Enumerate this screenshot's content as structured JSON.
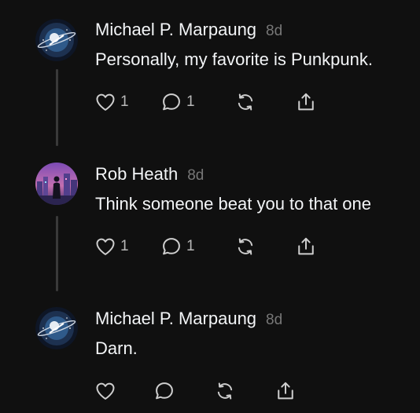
{
  "posts": [
    {
      "username": "Michael P. Marpaung",
      "time": "8d",
      "text": "Personally, my favorite is Punkpunk.",
      "likes": "1",
      "replies": "1",
      "avatar_icon": "astronaut-logo-icon"
    },
    {
      "username": "Rob Heath",
      "time": "8d",
      "text": "Think someone beat you to that one",
      "likes": "1",
      "replies": "1",
      "avatar_icon": "city-silhouette-icon"
    },
    {
      "username": "Michael P. Marpaung",
      "time": "8d",
      "text": "Darn.",
      "likes": "",
      "replies": "",
      "avatar_icon": "astronaut-logo-icon"
    }
  ],
  "colors": {
    "background": "#101010",
    "text": "#f3f5f7",
    "muted": "#777777",
    "thread_line": "#3a3a3a",
    "icon": "#cfcfcf"
  }
}
